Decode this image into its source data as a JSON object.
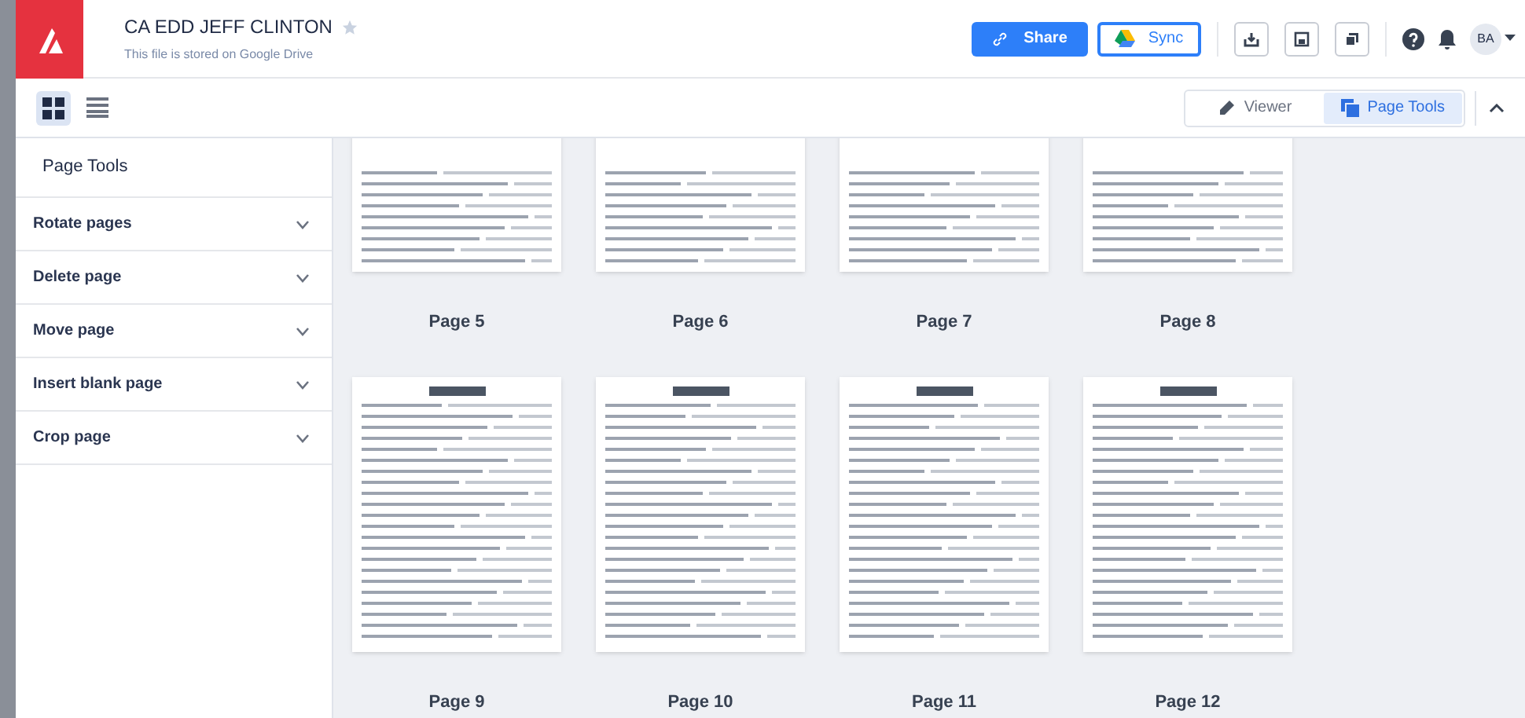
{
  "header": {
    "title": "CA EDD JEFF CLINTON",
    "starred": false,
    "subtitle": "This file is stored on Google Drive",
    "share_label": "Share",
    "sync_label": "Sync",
    "avatar": "BA"
  },
  "toolbar": {
    "views": [
      {
        "kind": "grid",
        "selected": true
      },
      {
        "kind": "list",
        "selected": false
      }
    ],
    "modes": [
      {
        "label": "Viewer",
        "kind": "pencil",
        "selected": false
      },
      {
        "label": "Page Tools",
        "kind": "pages",
        "selected": true
      }
    ]
  },
  "sidebar": {
    "title": "Page Tools",
    "items": [
      {
        "label": "Rotate pages",
        "expanded": false
      },
      {
        "label": "Delete page",
        "expanded": false
      },
      {
        "label": "Move page",
        "expanded": false
      },
      {
        "label": "Insert blank page",
        "expanded": false
      },
      {
        "label": "Crop page",
        "expanded": false
      }
    ]
  },
  "pages": [
    {
      "label": "Page 5",
      "cut_top": true
    },
    {
      "label": "Page 6",
      "cut_top": true
    },
    {
      "label": "Page 7",
      "cut_top": true
    },
    {
      "label": "Page 8",
      "cut_top": true
    },
    {
      "label": "Page 9",
      "cut_top": false
    },
    {
      "label": "Page 10",
      "cut_top": false
    },
    {
      "label": "Page 11",
      "cut_top": false
    },
    {
      "label": "Page 12",
      "cut_top": false
    }
  ]
}
